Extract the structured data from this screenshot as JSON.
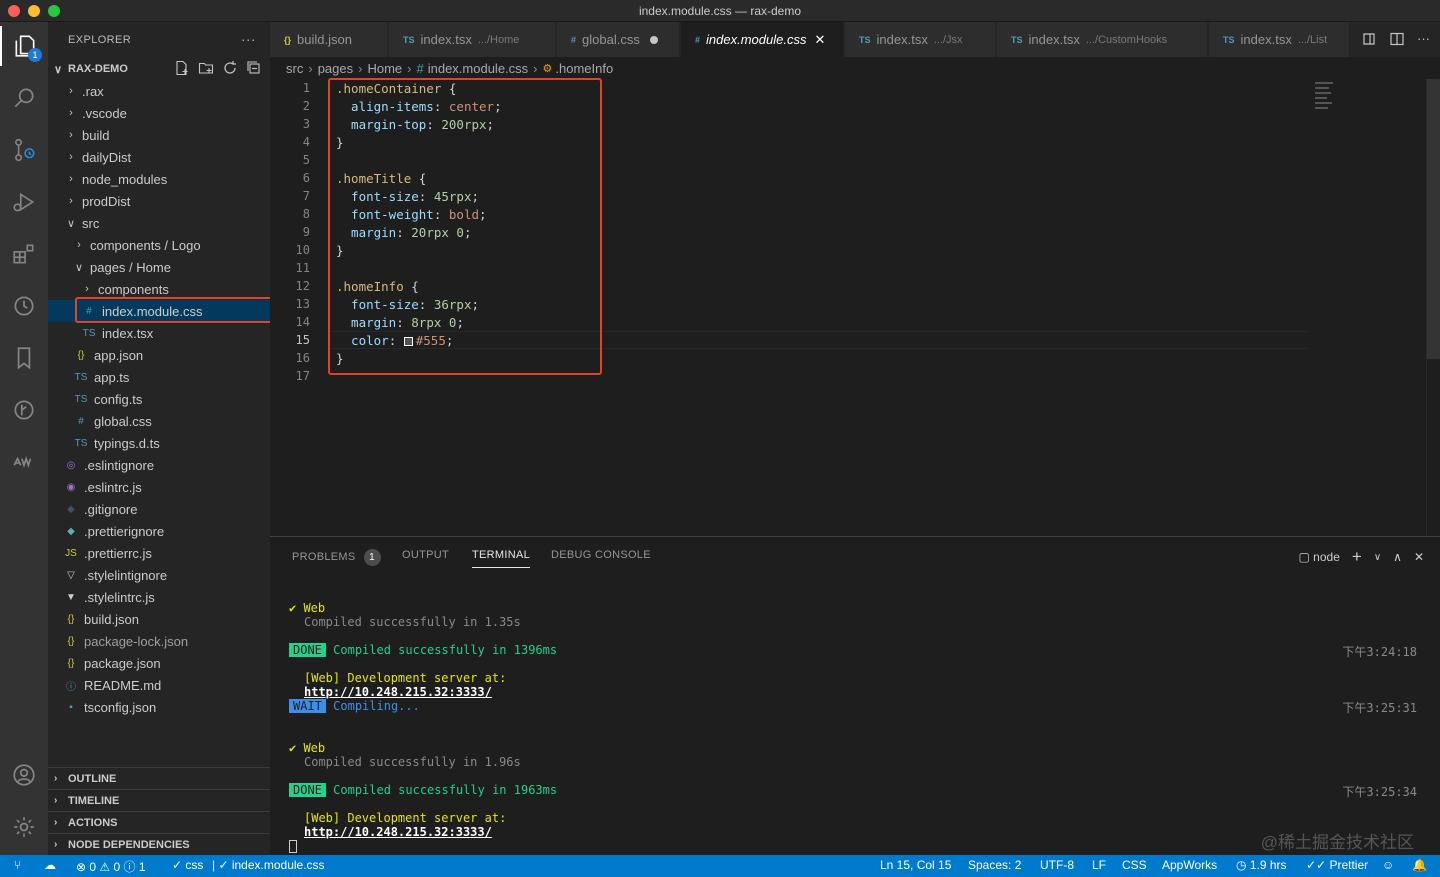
{
  "window": {
    "title": "index.module.css — rax-demo"
  },
  "activity": {
    "explorer_badge": "1"
  },
  "explorer": {
    "header": "EXPLORER",
    "more": "···",
    "project": "RAX-DEMO",
    "items": [
      {
        "label": ".rax",
        "kind": "folder",
        "expanded": false
      },
      {
        "label": ".vscode",
        "kind": "folder",
        "expanded": false
      },
      {
        "label": "build",
        "kind": "folder",
        "expanded": false
      },
      {
        "label": "dailyDist",
        "kind": "folder",
        "expanded": false
      },
      {
        "label": "node_modules",
        "kind": "folder",
        "expanded": false
      },
      {
        "label": "prodDist",
        "kind": "folder",
        "expanded": false
      },
      {
        "label": "src",
        "kind": "folder",
        "expanded": true
      },
      {
        "label": "components / Logo",
        "kind": "folder",
        "expanded": false
      },
      {
        "label": "pages / Home",
        "kind": "folder",
        "expanded": true
      },
      {
        "label": "components",
        "kind": "folder",
        "expanded": false
      },
      {
        "label": "index.module.css",
        "kind": "css",
        "icon": "#"
      },
      {
        "label": "index.tsx",
        "kind": "ts",
        "icon": "TS"
      },
      {
        "label": "app.json",
        "kind": "json",
        "icon": "{}"
      },
      {
        "label": "app.ts",
        "kind": "ts",
        "icon": "TS"
      },
      {
        "label": "config.ts",
        "kind": "ts",
        "icon": "TS"
      },
      {
        "label": "global.css",
        "kind": "css",
        "icon": "#"
      },
      {
        "label": "typings.d.ts",
        "kind": "ts",
        "icon": "TS"
      },
      {
        "label": ".eslintignore",
        "kind": "eslint",
        "icon": "◎"
      },
      {
        "label": ".eslintrc.js",
        "kind": "eslint",
        "icon": "◉"
      },
      {
        "label": ".gitignore",
        "kind": "git",
        "icon": "◆"
      },
      {
        "label": ".prettierignore",
        "kind": "prettier",
        "icon": "◆"
      },
      {
        "label": ".prettierrc.js",
        "kind": "js",
        "icon": "JS"
      },
      {
        "label": ".stylelintignore",
        "kind": "stylelint",
        "icon": "▽"
      },
      {
        "label": ".stylelintrc.js",
        "kind": "stylelint",
        "icon": "▼"
      },
      {
        "label": "build.json",
        "kind": "json",
        "icon": "{}"
      },
      {
        "label": "package-lock.json",
        "kind": "json",
        "icon": "{}"
      },
      {
        "label": "package.json",
        "kind": "json",
        "icon": "{}"
      },
      {
        "label": "README.md",
        "kind": "info",
        "icon": "ⓘ"
      },
      {
        "label": "tsconfig.json",
        "kind": "tsconfig",
        "icon": "▪"
      }
    ],
    "sections": [
      "OUTLINE",
      "TIMELINE",
      "ACTIONS",
      "NODE DEPENDENCIES"
    ]
  },
  "tabs": [
    {
      "icon": "{}",
      "label": "build.json",
      "sub": ""
    },
    {
      "icon": "TS",
      "label": "index.tsx",
      "sub": ".../Home"
    },
    {
      "icon": "#",
      "label": "global.css",
      "sub": ""
    },
    {
      "icon": "#",
      "label": "index.module.css",
      "sub": ""
    },
    {
      "icon": "TS",
      "label": "index.tsx",
      "sub": ".../Jsx"
    },
    {
      "icon": "TS",
      "label": "index.tsx",
      "sub": ".../CustomHooks"
    },
    {
      "icon": "TS",
      "label": "index.tsx",
      "sub": ".../List"
    }
  ],
  "breadcrumb": {
    "p1": "src",
    "p2": "pages",
    "p3": "Home",
    "p4": "index.module.css",
    "p5": ".homeInfo"
  },
  "editor": {
    "line_numbers": [
      "1",
      "2",
      "3",
      "4",
      "5",
      "6",
      "7",
      "8",
      "9",
      "10",
      "11",
      "12",
      "13",
      "14",
      "15",
      "16",
      "17"
    ],
    "code": [
      ".homeContainer {",
      "  align-items: center;",
      "  margin-top: 200rpx;",
      "}",
      "",
      ".homeTitle {",
      "  font-size: 45rpx;",
      "  font-weight: bold;",
      "  margin: 20rpx 0;",
      "}",
      "",
      ".homeInfo {",
      "  font-size: 36rpx;",
      "  margin: 8rpx 0;",
      "  color: #555;",
      "}",
      ""
    ],
    "current_line": "15"
  },
  "panel": {
    "tabs": {
      "problems": "PROBLEMS",
      "problems_count": "1",
      "output": "OUTPUT",
      "terminal": "TERMINAL",
      "debug": "DEBUG CONSOLE"
    },
    "shell": "node",
    "terminal": {
      "check1": "✔ Web",
      "compiled1": "Compiled successfully in 1.35s",
      "done1_tag": "DONE",
      "done1_text": "Compiled successfully in 1396ms",
      "time1": "下午3:24:18",
      "server1": "[Web] Development server at:",
      "url1": "http://10.248.215.32:3333/",
      "wait_tag": "WAIT",
      "wait_text": "Compiling...",
      "time2": "下午3:25:31",
      "check2": "✔ Web",
      "compiled2": "Compiled successfully in 1.96s",
      "done2_tag": "DONE",
      "done2_text": "Compiled successfully in 1963ms",
      "time3": "下午3:25:34",
      "server2": "[Web] Development server at:",
      "url2": "http://10.248.215.32:3333/"
    },
    "watermark": "@稀土掘金技术社区"
  },
  "statusbar": {
    "errors": "0",
    "warnings": "0",
    "info": "1",
    "lint_css": "css",
    "lint_file": "index.module.css",
    "position": "Ln 15, Col 15",
    "spaces": "Spaces: 2",
    "encoding": "UTF-8",
    "eol": "LF",
    "language": "CSS",
    "appworks": "AppWorks",
    "time": "1.9 hrs",
    "prettier": "Prettier"
  }
}
